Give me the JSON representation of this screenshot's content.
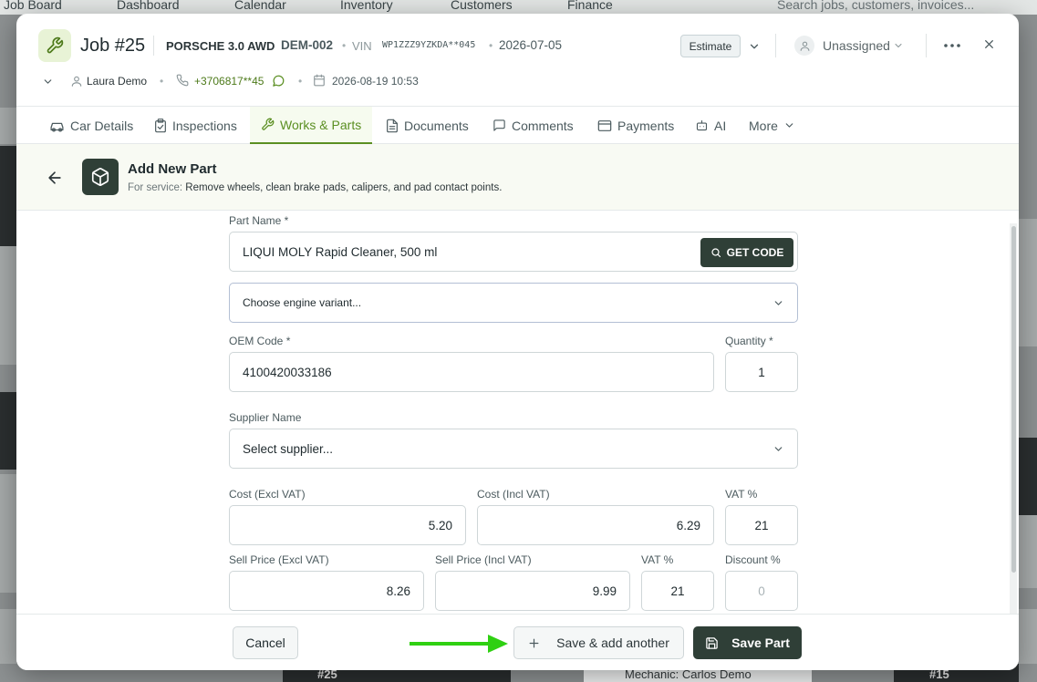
{
  "background": {
    "nav_items": [
      "Job Board",
      "Dashboard",
      "Calendar",
      "Inventory",
      "Customers",
      "Finance"
    ],
    "search_placeholder": "Search jobs, customers, invoices...",
    "bottom_job_left": "#25",
    "bottom_mechanic": "Mechanic: Carlos Demo",
    "bottom_job_right": "#15"
  },
  "job": {
    "title": "Job #25",
    "car": "PORSCHE 3.0 AWD",
    "plate": "DEM-002",
    "vin_label": "VIN",
    "vin": "WP1ZZZ9YZKDA**045",
    "date": "2026-07-05",
    "status": "Estimate",
    "assignee": "Unassigned",
    "customer": "Laura Demo",
    "phone": "+3706817**45",
    "appointment": "2026-08-19 10:53"
  },
  "tabs": [
    {
      "label": "Car Details",
      "icon": "car-icon"
    },
    {
      "label": "Inspections",
      "icon": "clipboard-icon"
    },
    {
      "label": "Works & Parts",
      "icon": "wrench-icon",
      "active": true
    },
    {
      "label": "Documents",
      "icon": "document-icon"
    },
    {
      "label": "Comments",
      "icon": "comment-icon"
    },
    {
      "label": "Payments",
      "icon": "card-icon"
    },
    {
      "label": "AI",
      "icon": "robot-icon"
    },
    {
      "label": "More",
      "icon": "chevron-down-icon"
    }
  ],
  "section": {
    "title": "Add New Part",
    "service_prefix": "For service:",
    "service": "Remove wheels, clean brake pads, calipers, and pad contact points."
  },
  "form": {
    "part_name_label": "Part Name *",
    "part_name": "LIQUI MOLY Rapid Cleaner, 500 ml",
    "get_code_label": "GET CODE",
    "engine_variant_placeholder": "Choose engine variant...",
    "oem_label": "OEM Code *",
    "oem_code": "4100420033186",
    "quantity_label": "Quantity *",
    "quantity": "1",
    "supplier_label": "Supplier Name",
    "supplier_placeholder": "Select supplier...",
    "cost_excl_label": "Cost (Excl VAT)",
    "cost_excl": "5.20",
    "cost_incl_label": "Cost (Incl VAT)",
    "cost_incl": "6.29",
    "cost_vat_label": "VAT %",
    "cost_vat": "21",
    "sell_excl_label": "Sell Price (Excl VAT)",
    "sell_excl": "8.26",
    "sell_incl_label": "Sell Price (Incl VAT)",
    "sell_incl": "9.99",
    "sell_vat_label": "VAT %",
    "sell_vat": "21",
    "discount_label": "Discount %",
    "discount_placeholder": "0"
  },
  "footer": {
    "cancel": "Cancel",
    "save_add": "Save & add another",
    "save": "Save Part"
  },
  "colors": {
    "accent": "#5b8f22",
    "primary_dark": "#2f3f37",
    "arrow": "#2fd012"
  }
}
